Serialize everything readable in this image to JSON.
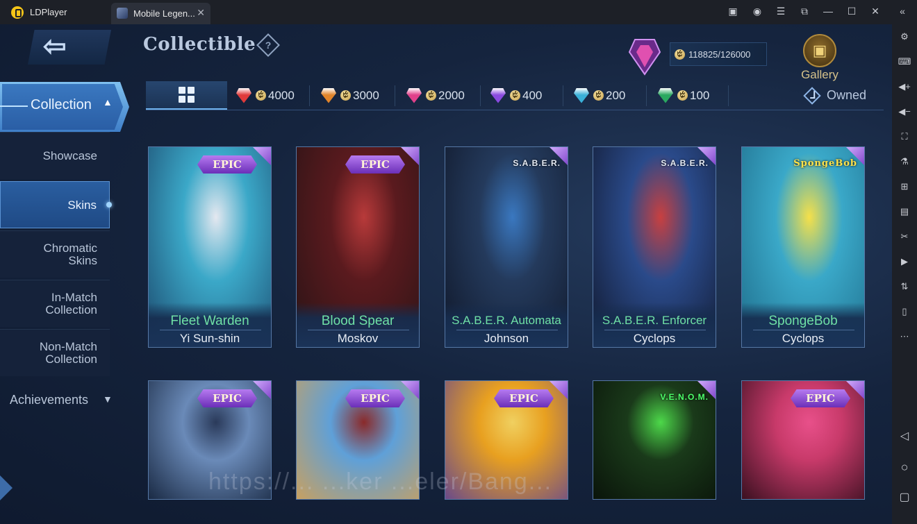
{
  "app": {
    "name": "LDPlayer",
    "tab_title": "Mobile Legen...",
    "tab_close": "✕",
    "window_controls": [
      "▣",
      "◉",
      "☰",
      "⧉",
      "—",
      "☐",
      "✕",
      "«"
    ]
  },
  "sidebar_tools": [
    "gear-icon",
    "keyboard-icon",
    "volume-up-icon",
    "volume-down-icon",
    "screenshot-icon",
    "robot-icon",
    "add-window-icon",
    "apk-icon",
    "scissors-icon",
    "record-icon",
    "sync-icon",
    "shake-icon",
    "more-icon"
  ],
  "sidebar_nav": [
    "◁",
    "○",
    "▢"
  ],
  "header": {
    "back_glyph": "⇦",
    "title": "Collectible",
    "help": "?",
    "points_current": "118825",
    "points_total": "126000",
    "points_text": "118825/126000",
    "gallery_label": "Gallery"
  },
  "nav": {
    "collection_label": "Collection",
    "items": [
      {
        "label": "Showcase"
      },
      {
        "label": "Skins",
        "active": true
      },
      {
        "label": "Chromatic\nSkins"
      },
      {
        "label": "In-Match\nCollection"
      },
      {
        "label": "Non-Match\nCollection"
      }
    ],
    "achievements_label": "Achievements"
  },
  "filters": {
    "tiers": [
      {
        "value": "4000",
        "color": "#e03a3a"
      },
      {
        "value": "3000",
        "color": "#e0842a"
      },
      {
        "value": "2000",
        "color": "#e0408a"
      },
      {
        "value": "400",
        "color": "#8a4ae0"
      },
      {
        "value": "200",
        "color": "#3ab0d8"
      },
      {
        "value": "100",
        "color": "#2aa860"
      }
    ],
    "owned_label": "Owned"
  },
  "cards": [
    {
      "skin": "Fleet Warden",
      "hero": "Yi Sun-shin",
      "badge": "EPIC",
      "brand": "",
      "colors": [
        "#3ba8c8",
        "#1c4a6e",
        "#e4e8f0"
      ]
    },
    {
      "skin": "Blood Spear",
      "hero": "Moskov",
      "badge": "EPIC",
      "brand": "",
      "colors": [
        "#5a1a1e",
        "#2a1416",
        "#b83a3a"
      ]
    },
    {
      "skin": "S.A.B.E.R. Automata",
      "hero": "Johnson",
      "badge": "",
      "brand": "S.A.B.E.R.",
      "colors": [
        "#243a5c",
        "#10182a",
        "#3a78c0"
      ]
    },
    {
      "skin": "S.A.B.E.R. Enforcer",
      "hero": "Cyclops",
      "badge": "",
      "brand": "S.A.B.E.R.",
      "colors": [
        "#2a4a8a",
        "#121a30",
        "#c84040"
      ]
    },
    {
      "skin": "SpongeBob",
      "hero": "Cyclops",
      "badge": "",
      "brand": "SpongeBob",
      "colors": [
        "#3aa8c8",
        "#1f6e8c",
        "#f5e04a"
      ]
    },
    {
      "skin": "",
      "hero": "",
      "badge": "EPIC",
      "brand": "",
      "colors": [
        "#6a8ab8",
        "#1a2a44",
        "#2a3a5a"
      ]
    },
    {
      "skin": "",
      "hero": "",
      "badge": "EPIC",
      "brand": "",
      "colors": [
        "#5fa0d8",
        "#c8a060",
        "#8a2a2a"
      ]
    },
    {
      "skin": "",
      "hero": "",
      "badge": "EPIC",
      "brand": "",
      "colors": [
        "#e8a020",
        "#6a4a8a",
        "#f0d060"
      ]
    },
    {
      "skin": "",
      "hero": "",
      "badge": "",
      "brand": "V.E.N.O.M.",
      "colors": [
        "#1a3a1a",
        "#0a140a",
        "#4dd84a"
      ]
    },
    {
      "skin": "",
      "hero": "",
      "badge": "EPIC",
      "brand": "",
      "colors": [
        "#c83a6a",
        "#3a1020",
        "#e8508a"
      ]
    }
  ],
  "watermark": "https://... ...ker ...eler/Bang..."
}
